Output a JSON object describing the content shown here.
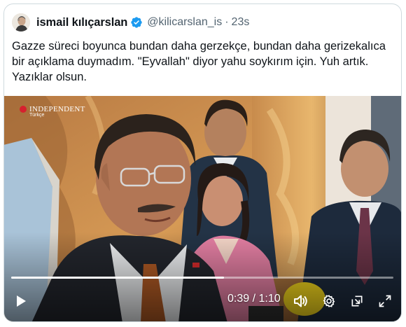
{
  "author": {
    "display_name": "ismail kılıçarslan",
    "handle": "@kilicarslan_is",
    "separator": "·",
    "time": "23s",
    "verified": true
  },
  "tweet": {
    "text": "Gazze süreci boyunca bundan daha gerzekçe, bundan daha gerizekalıca bir açıklama duymadım. \"Eyvallah\" diyor yahu soykırım için. Yuh artık. Yazıklar olsun."
  },
  "video": {
    "watermark": {
      "name": "INDEPENDENT",
      "sub": "Türkçe"
    },
    "current_time": "0:39",
    "duration": "1:10",
    "time_separator": " / ",
    "progress_fraction": 0.557
  },
  "colors": {
    "verified_blue": "#1d9bf0",
    "muted_text": "#536471",
    "border": "#cfd9de"
  },
  "icons": {
    "play": "play-icon",
    "volume": "volume-icon",
    "settings": "gear-icon",
    "pip": "picture-in-picture-icon",
    "fullscreen": "fullscreen-icon"
  }
}
